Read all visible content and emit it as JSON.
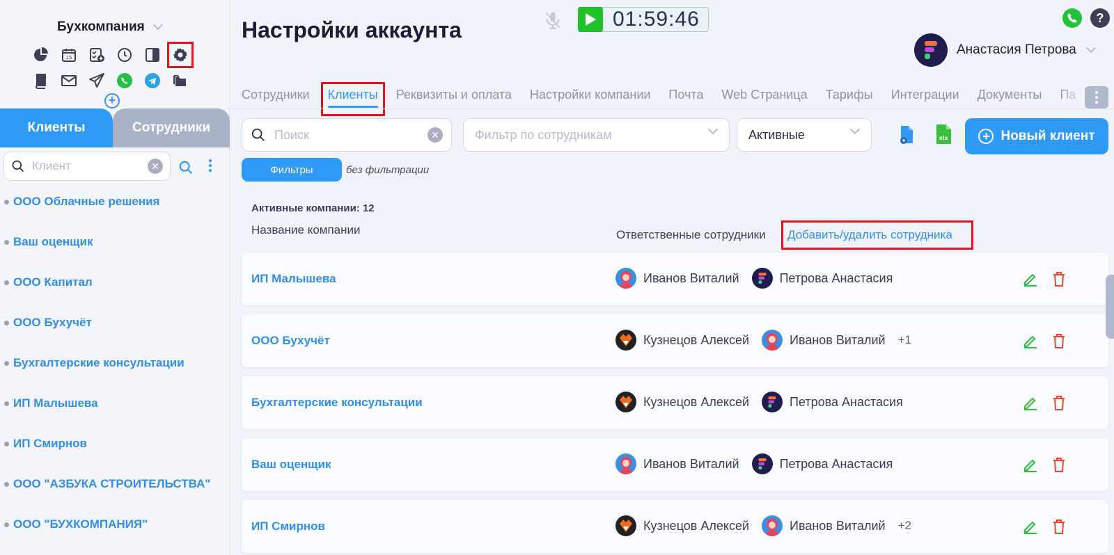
{
  "sidebar": {
    "company_name": "Бухкомпания",
    "icons_row1": [
      "pie-chart-icon",
      "calendar-icon",
      "task-list-icon",
      "clock-icon",
      "sidebar-toggle-icon",
      "gear-icon"
    ],
    "icons_row2": [
      "book-icon",
      "mail-icon",
      "send-icon",
      "whatsapp-icon",
      "telegram-icon",
      "folders-icon"
    ],
    "tabs": [
      "Клиенты",
      "Сотрудники"
    ],
    "search_placeholder": "Клиент",
    "clients": [
      "ООО Облачные решения",
      "Ваш оценщик",
      "ООО Капитал",
      "ООО Бухучёт",
      "Бухгалтерские консультации",
      "ИП Малышева",
      "ИП Смирнов",
      "ООО \"АЗБУКА СТРОИТЕЛЬСТВА\"",
      "ООО \"БУХКОМПАНИЯ\""
    ]
  },
  "header": {
    "title": "Настройки аккаунта",
    "timer": "01:59:46",
    "user_name": "Анастасия Петрова"
  },
  "tabs": [
    "Сотрудники",
    "Клиенты",
    "Реквизиты и оплата",
    "Настройки компании",
    "Почта",
    "Web Страница",
    "Тарифы",
    "Интеграции",
    "Документы",
    "Па"
  ],
  "active_tab": "Клиенты",
  "toolbar": {
    "search_placeholder": "Поиск",
    "employee_filter_placeholder": "Фильтр по сотрудникам",
    "status_value": "Активные",
    "new_client_label": "Новый клиент",
    "filters_label": "Фильтры",
    "filters_note": "без фильтрации"
  },
  "table": {
    "count_label": "Активные компании: 12",
    "col_company": "Название компании",
    "col_employees": "Ответственные сотрудники",
    "add_remove_link": "Добавить/удалить сотрудника",
    "rows": [
      {
        "company": "ИП Малышева",
        "emp1": "Иванов Виталий",
        "emp2": "Петрова Анастасия",
        "more": ""
      },
      {
        "company": "ООО Бухучёт",
        "emp1": "Кузнецов Алексей",
        "emp2": "Иванов Виталий",
        "more": "+1"
      },
      {
        "company": "Бухгалтерские консультации",
        "emp1": "Кузнецов Алексей",
        "emp2": "Петрова Анастасия",
        "more": ""
      },
      {
        "company": "Ваш оценщик",
        "emp1": "Иванов Виталий",
        "emp2": "Петрова Анастасия",
        "more": ""
      },
      {
        "company": "ИП Смирнов",
        "emp1": "Кузнецов Алексей",
        "emp2": "Иванов Виталий",
        "more": "+2"
      }
    ]
  },
  "colors": {
    "accent": "#2f9af5",
    "highlight": "#e3141b",
    "edit": "#27c23a",
    "delete": "#f0432a"
  }
}
